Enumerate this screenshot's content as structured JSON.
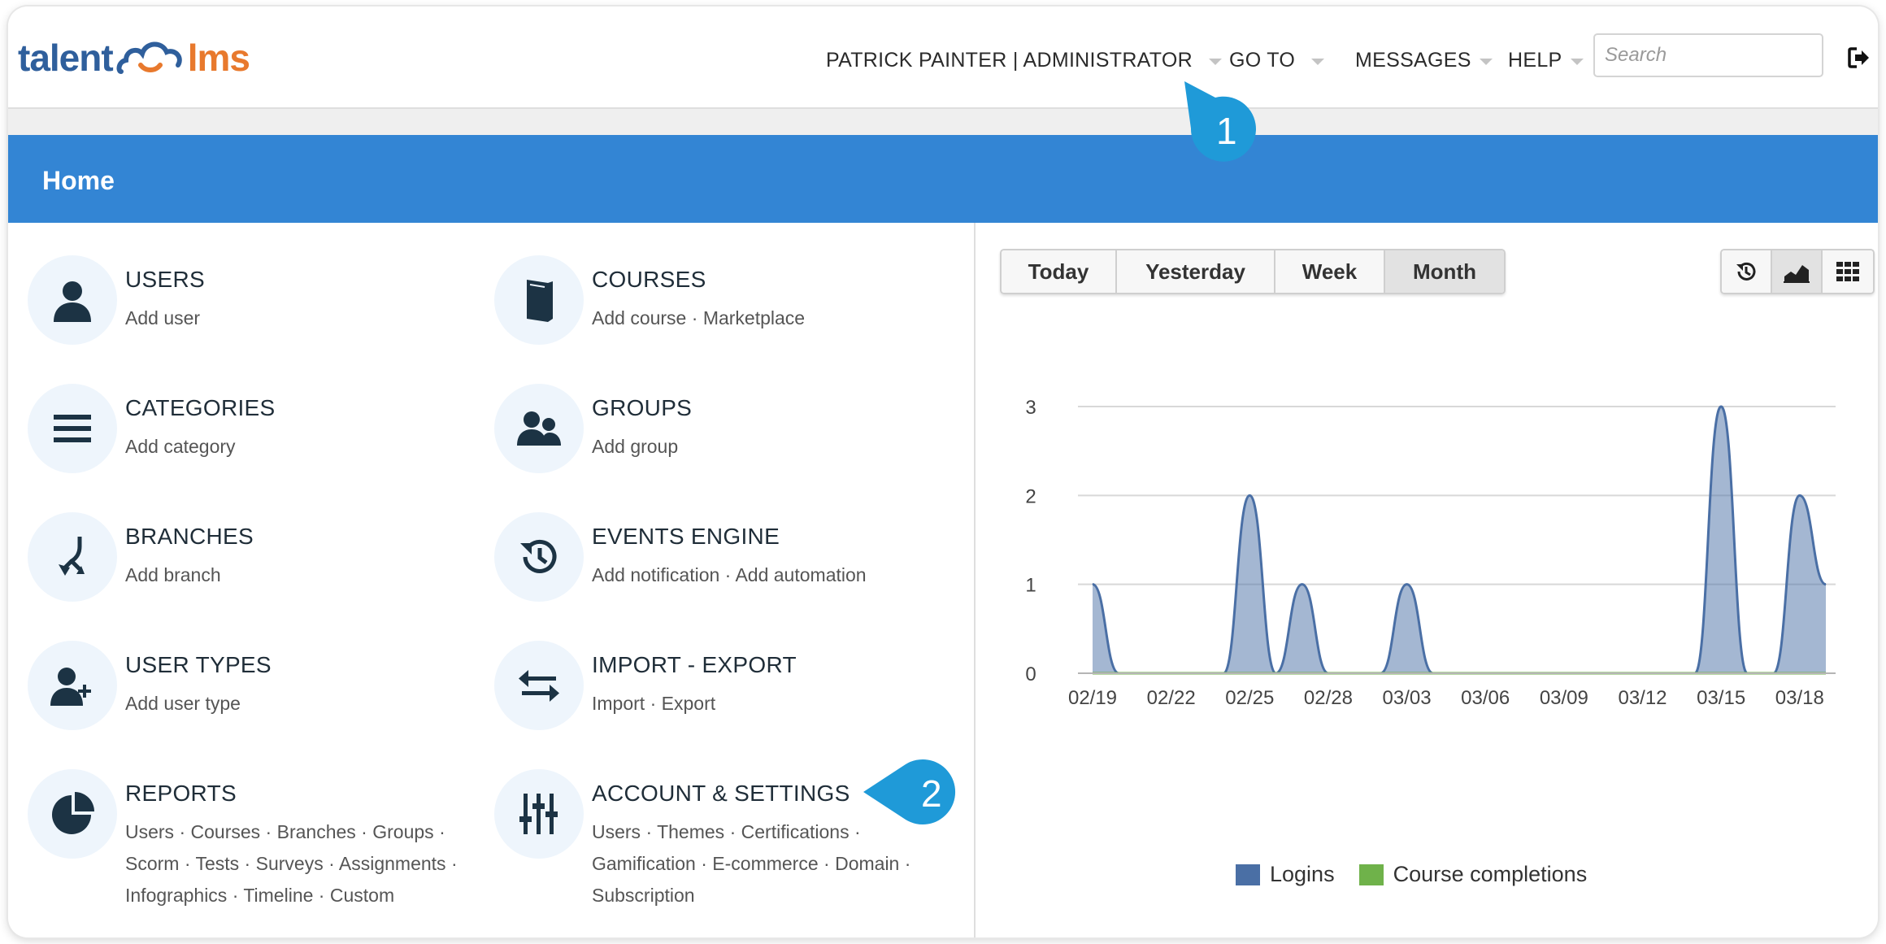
{
  "header": {
    "logo_left": "talent",
    "logo_right": "lms",
    "user_menu": "PATRICK PAINTER | ADMINISTRATOR",
    "goto_menu": "GO TO",
    "messages_menu": "MESSAGES",
    "help_menu": "HELP",
    "search_placeholder": "Search"
  },
  "page": {
    "title": "Home"
  },
  "callouts": [
    "1",
    "2"
  ],
  "tiles": [
    {
      "title": "USERS",
      "icon": "user-icon",
      "links": [
        "Add user"
      ]
    },
    {
      "title": "COURSES",
      "icon": "book-icon",
      "links": [
        "Add course",
        "Marketplace"
      ]
    },
    {
      "title": "CATEGORIES",
      "icon": "list-icon",
      "links": [
        "Add category"
      ]
    },
    {
      "title": "GROUPS",
      "icon": "users-icon",
      "links": [
        "Add group"
      ]
    },
    {
      "title": "BRANCHES",
      "icon": "branch-icon",
      "links": [
        "Add branch"
      ]
    },
    {
      "title": "EVENTS ENGINE",
      "icon": "history-icon",
      "links": [
        "Add notification",
        "Add automation"
      ]
    },
    {
      "title": "USER TYPES",
      "icon": "user-plus-icon",
      "links": [
        "Add user type"
      ]
    },
    {
      "title": "IMPORT - EXPORT",
      "icon": "exchange-icon",
      "links": [
        "Import",
        "Export"
      ]
    },
    {
      "title": "REPORTS",
      "icon": "pie-chart-icon",
      "links": [
        "Users",
        "Courses",
        "Branches",
        "Groups",
        "Scorm",
        "Tests",
        "Surveys",
        "Assignments",
        "Infographics",
        "Timeline",
        "Custom"
      ]
    },
    {
      "title": "ACCOUNT & SETTINGS",
      "icon": "sliders-icon",
      "links": [
        "Users",
        "Themes",
        "Certifications",
        "Gamification",
        "E-commerce",
        "Domain",
        "Subscription"
      ]
    }
  ],
  "range_tabs": [
    {
      "label": "Today",
      "active": false
    },
    {
      "label": "Yesterday",
      "active": false
    },
    {
      "label": "Week",
      "active": false
    },
    {
      "label": "Month",
      "active": true
    }
  ],
  "view_tabs": [
    {
      "icon": "history-icon",
      "active": false
    },
    {
      "icon": "area-chart-icon",
      "active": true
    },
    {
      "icon": "grid-icon",
      "active": false
    }
  ],
  "colors": {
    "accent": "#3385d4",
    "logins": "#4a6fa5",
    "completions": "#6fb24a"
  },
  "chart_data": {
    "type": "area",
    "x": [
      "02/19",
      "02/20",
      "02/21",
      "02/22",
      "02/23",
      "02/24",
      "02/25",
      "02/26",
      "02/27",
      "02/28",
      "03/01",
      "03/02",
      "03/03",
      "03/04",
      "03/05",
      "03/06",
      "03/07",
      "03/08",
      "03/09",
      "03/10",
      "03/11",
      "03/12",
      "03/13",
      "03/14",
      "03/15",
      "03/16",
      "03/17",
      "03/18",
      "03/19"
    ],
    "x_tick_labels": [
      "02/19",
      "02/22",
      "02/25",
      "02/28",
      "03/03",
      "03/06",
      "03/09",
      "03/12",
      "03/15",
      "03/18"
    ],
    "series": [
      {
        "name": "Logins",
        "values": [
          1,
          0,
          0,
          0,
          0,
          0,
          2,
          0,
          1,
          0,
          0,
          0,
          1,
          0,
          0,
          0,
          0,
          0,
          0,
          0,
          0,
          0,
          0,
          0,
          3,
          0,
          0,
          2,
          1
        ]
      },
      {
        "name": "Course completions",
        "values": [
          0,
          0,
          0,
          0,
          0,
          0,
          0,
          0,
          0,
          0,
          0,
          0,
          0,
          0,
          0,
          0,
          0,
          0,
          0,
          0,
          0,
          0,
          0,
          0,
          0,
          0,
          0,
          0,
          0
        ]
      }
    ],
    "y_ticks": [
      0,
      1,
      2,
      3
    ],
    "ylim": [
      0,
      3
    ],
    "grid": true,
    "legend": "bottom"
  }
}
